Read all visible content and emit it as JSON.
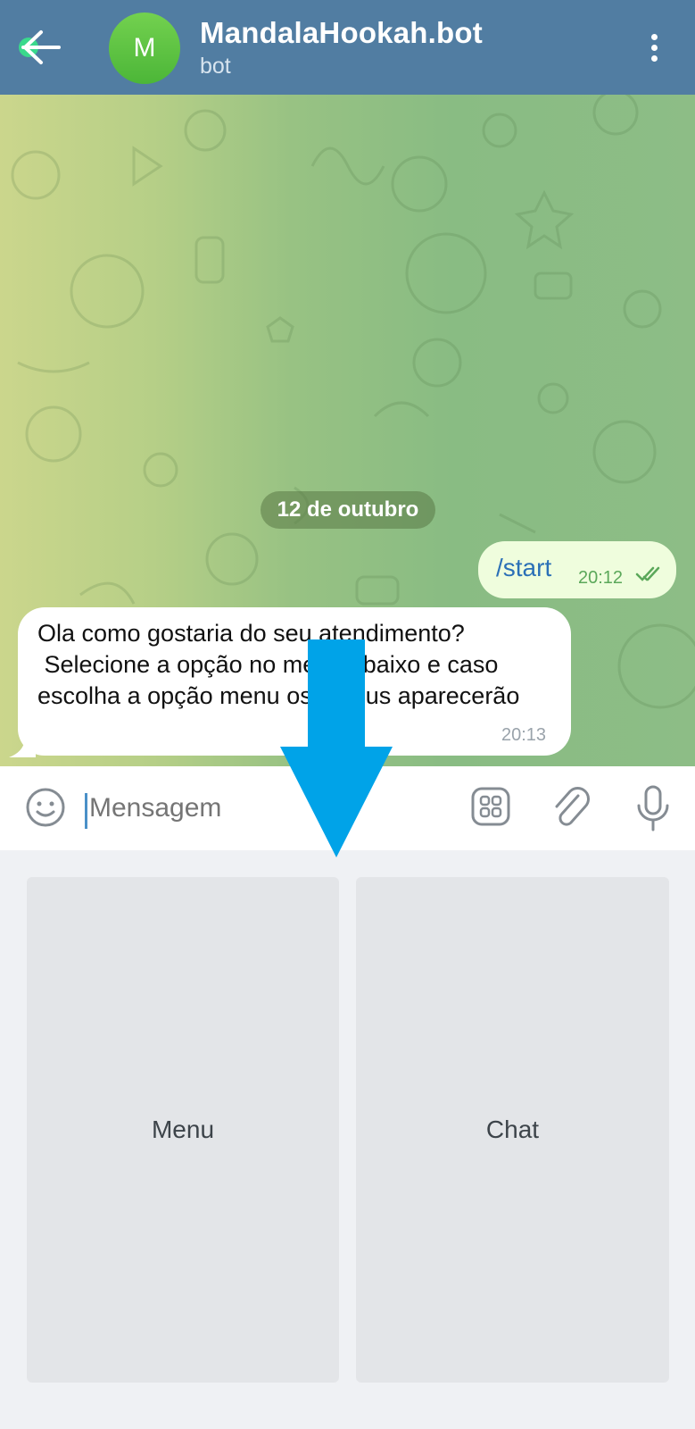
{
  "header": {
    "avatar_letter": "M",
    "title": "MandalaHookah.bot",
    "subtitle": "bot",
    "background": "#517da2",
    "icons": {
      "back": "back-arrow-icon",
      "menu": "kebab-menu-icon"
    }
  },
  "chat": {
    "date_label": "12 de outubro",
    "messages": [
      {
        "direction": "outgoing",
        "text": "/start",
        "time": "20:12",
        "status": "read"
      },
      {
        "direction": "incoming",
        "text": "Ola como gostaria do seu atendimento?\n Selecione a opção no menu abaixo e caso escolha a opção menu os menus aparecerão",
        "time": "20:13"
      }
    ]
  },
  "input": {
    "placeholder": "Mensagem",
    "icons": [
      "emoji-icon",
      "apps-icon",
      "attach-icon",
      "mic-icon"
    ]
  },
  "keyboard": {
    "buttons": [
      {
        "label": "Menu"
      },
      {
        "label": "Chat"
      }
    ]
  },
  "overlay": {
    "arrow_color": "#00a3e8",
    "direction": "down"
  }
}
